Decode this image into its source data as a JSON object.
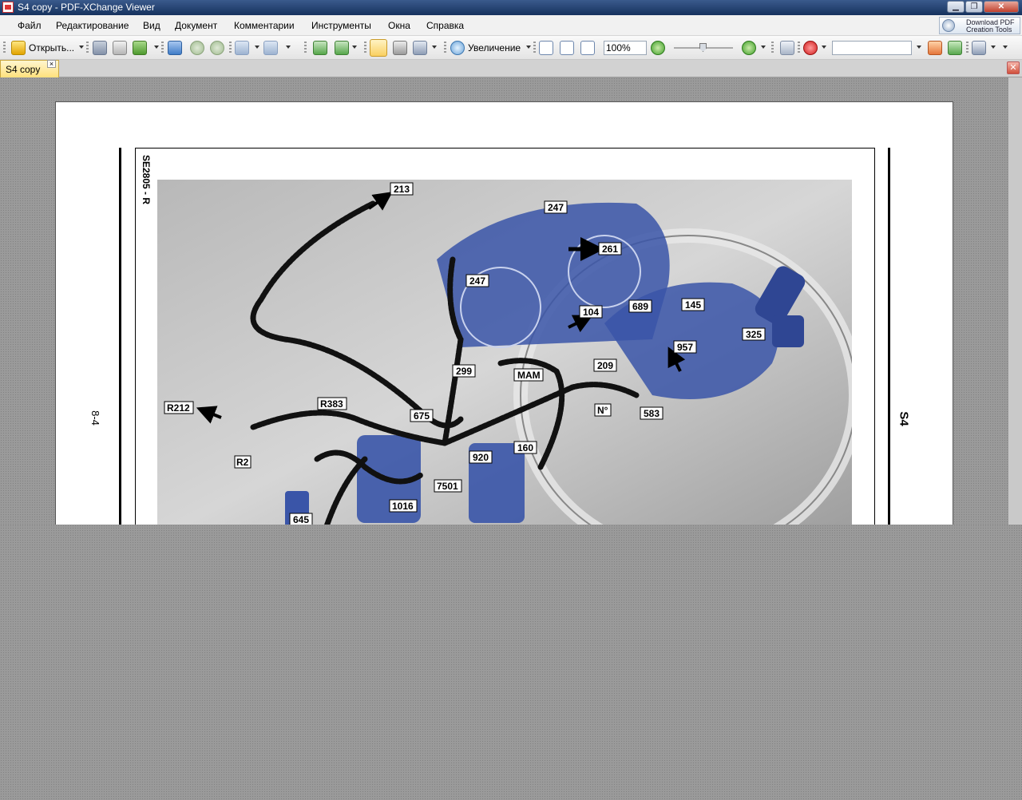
{
  "window": {
    "title": "S4 copy - PDF-XChange Viewer"
  },
  "promo": {
    "line1": "Download PDF",
    "line2": "Creation Tools"
  },
  "menu": [
    "Файл",
    "Редактирование",
    "Вид",
    "Документ",
    "Комментарии",
    "Инструменты",
    "Окна",
    "Справка"
  ],
  "toolbar": {
    "open_label": "Открыть...",
    "zoom_tool_label": "Увеличение",
    "zoom_value": "100%",
    "find_value": ""
  },
  "tab": {
    "label": "S4 copy",
    "close": "×"
  },
  "document": {
    "code": "SE2805 - R",
    "left_side_label": "8-4",
    "right_side_label": "S4",
    "callouts": [
      "213",
      "247",
      "261",
      "247",
      "104",
      "689",
      "145",
      "325",
      "957",
      "299",
      "MAM",
      "209",
      "R212",
      "R383",
      "675",
      "N°",
      "583",
      "R2",
      "920",
      "160",
      "7501",
      "1016",
      "645"
    ]
  },
  "colors": {
    "tab_active": "#ffe17c",
    "titlebar": "#16325e",
    "harness_blue": "#3a55a8"
  }
}
